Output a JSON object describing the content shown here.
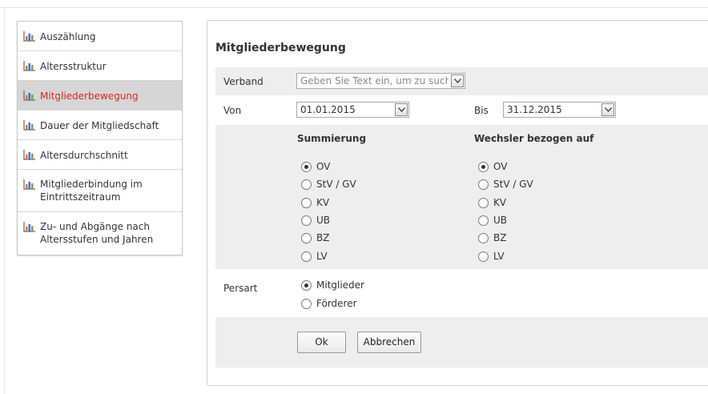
{
  "sidebar": {
    "items": [
      {
        "label": "Auszählung",
        "active": false
      },
      {
        "label": "Altersstruktur",
        "active": false
      },
      {
        "label": "Mitgliederbewegung",
        "active": true
      },
      {
        "label": "Dauer der Mitgliedschaft",
        "active": false
      },
      {
        "label": "Altersdurchschnitt",
        "active": false
      },
      {
        "label": "Mitgliederbindung im Eintrittszeitraum",
        "active": false
      },
      {
        "label": "Zu- und Abgänge nach Altersstufen und Jahren",
        "active": false
      }
    ],
    "icon": "bar-chart-icon",
    "active_color": "#d9261c"
  },
  "form": {
    "title": "Mitgliederbewegung",
    "verband": {
      "label": "Verband",
      "placeholder": "Geben Sie Text ein, um zu suchen"
    },
    "von": {
      "label": "Von",
      "value": "01.01.2015"
    },
    "bis": {
      "label": "Bis",
      "value": "31.12.2015"
    },
    "summierung": {
      "heading": "Summierung",
      "options": [
        "OV",
        "StV / GV",
        "KV",
        "UB",
        "BZ",
        "LV"
      ],
      "selected": "OV"
    },
    "wechsler": {
      "heading": "Wechsler bezogen auf",
      "options": [
        "OV",
        "StV / GV",
        "KV",
        "UB",
        "BZ",
        "LV"
      ],
      "selected": "OV"
    },
    "persart": {
      "label": "Persart",
      "options": [
        "Mitglieder",
        "Förderer"
      ],
      "selected": "Mitglieder"
    },
    "buttons": {
      "ok": "Ok",
      "cancel": "Abbrechen"
    }
  }
}
